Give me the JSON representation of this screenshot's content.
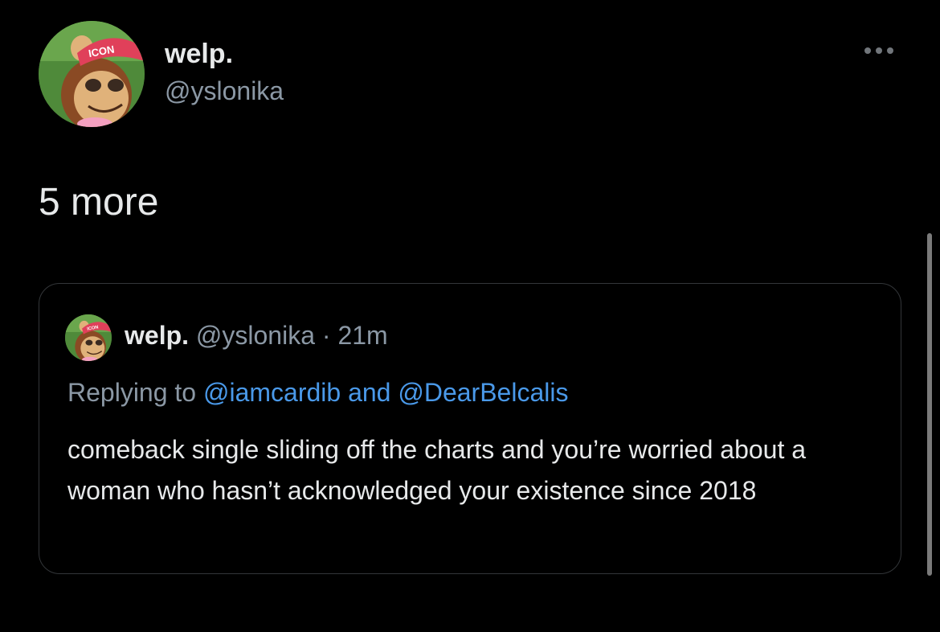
{
  "tweet": {
    "display_name": "welp.",
    "handle": "@yslonika",
    "text": "5 more",
    "more_icon": "ellipsis-icon",
    "avatar_cap_text": "ICON"
  },
  "quoted_tweet": {
    "display_name": "welp.",
    "handle_time": "@yslonika · 21m",
    "replying_prefix": "Replying to",
    "mention_1": "@iamcardib",
    "mention_joiner": "and",
    "mention_2": "@DearBelcalis",
    "body": "comeback single sliding off the charts and you’re worried about a woman who hasn’t acknowledged your existence since 2018",
    "avatar_cap_text": "ICON"
  },
  "colors": {
    "background": "#000000",
    "primary_text": "#e7e9ea",
    "secondary_text": "#8b98a5",
    "link": "#4a99e9",
    "border": "#333639"
  }
}
